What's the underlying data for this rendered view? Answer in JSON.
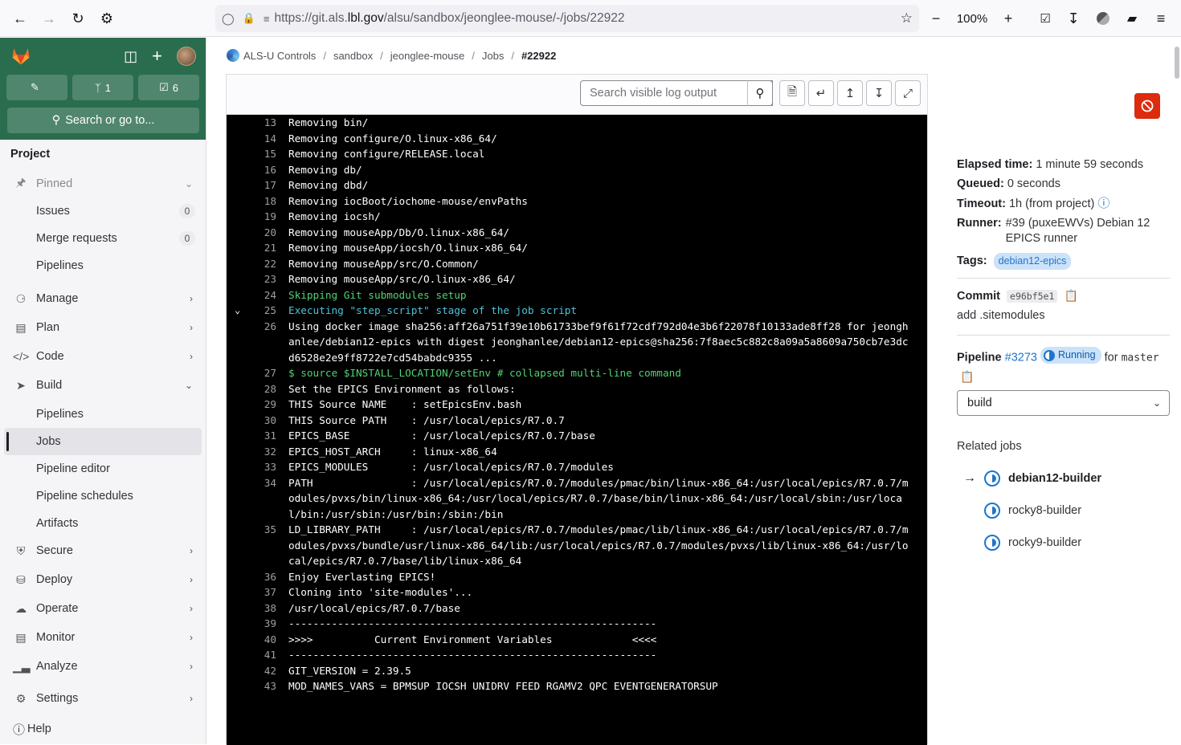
{
  "browser": {
    "url_prefix": "https://git.als.",
    "url_domain": "lbl.gov",
    "url_path": "/alsu/sandbox/jeonglee-mouse/-/jobs/22922",
    "zoom": "100%"
  },
  "sidebar": {
    "counters": [
      {
        "icon": "issues-icon",
        "value": ""
      },
      {
        "icon": "merge-request-icon",
        "value": "1"
      },
      {
        "icon": "todo-icon",
        "value": "6"
      }
    ],
    "search_label": "Search or go to...",
    "section_title": "Project",
    "pinned_label": "Pinned",
    "pinned_items": [
      {
        "label": "Issues",
        "count": "0"
      },
      {
        "label": "Merge requests",
        "count": "0"
      },
      {
        "label": "Pipelines",
        "count": ""
      }
    ],
    "groups": {
      "manage": "Manage",
      "plan": "Plan",
      "code": "Code",
      "build": "Build",
      "secure": "Secure",
      "deploy": "Deploy",
      "operate": "Operate",
      "monitor": "Monitor",
      "analyze": "Analyze",
      "settings": "Settings"
    },
    "build_items": [
      "Pipelines",
      "Jobs",
      "Pipeline editor",
      "Pipeline schedules",
      "Artifacts"
    ],
    "help_label": "Help"
  },
  "breadcrumb": {
    "org": "ALS-U Controls",
    "group": "sandbox",
    "project": "jeonglee-mouse",
    "section": "Jobs",
    "current": "#22922"
  },
  "log_toolbar": {
    "search_placeholder": "Search visible log output"
  },
  "log_lines": [
    {
      "n": "13",
      "t": "Removing bin/",
      "c": ""
    },
    {
      "n": "14",
      "t": "Removing configure/O.linux-x86_64/",
      "c": ""
    },
    {
      "n": "15",
      "t": "Removing configure/RELEASE.local",
      "c": ""
    },
    {
      "n": "16",
      "t": "Removing db/",
      "c": ""
    },
    {
      "n": "17",
      "t": "Removing dbd/",
      "c": ""
    },
    {
      "n": "18",
      "t": "Removing iocBoot/iochome-mouse/envPaths",
      "c": ""
    },
    {
      "n": "19",
      "t": "Removing iocsh/",
      "c": ""
    },
    {
      "n": "20",
      "t": "Removing mouseApp/Db/O.linux-x86_64/",
      "c": ""
    },
    {
      "n": "21",
      "t": "Removing mouseApp/iocsh/O.linux-x86_64/",
      "c": ""
    },
    {
      "n": "22",
      "t": "Removing mouseApp/src/O.Common/",
      "c": ""
    },
    {
      "n": "23",
      "t": "Removing mouseApp/src/O.linux-x86_64/",
      "c": ""
    },
    {
      "n": "24",
      "t": "Skipping Git submodules setup",
      "c": "green"
    },
    {
      "n": "25",
      "t": "Executing \"step_script\" stage of the job script",
      "c": "cyan"
    },
    {
      "n": "26",
      "t": "Using docker image sha256:aff26a751f39e10b61733bef9f61f72cdf792d04e3b6f22078f10133ade8ff28 for jeonghanlee/debian12-epics with digest jeonghanlee/debian12-epics@sha256:7f8aec5c882c8a09a5a8609a750cb7e3dcd6528e2e9ff8722e7cd54babdc9355 ...",
      "c": ""
    },
    {
      "n": "27",
      "t": "$ source $INSTALL_LOCATION/setEnv # collapsed multi-line command",
      "c": "green2"
    },
    {
      "n": "28",
      "t": "Set the EPICS Environment as follows:",
      "c": ""
    },
    {
      "n": "29",
      "t": "THIS Source NAME    : setEpicsEnv.bash",
      "c": ""
    },
    {
      "n": "30",
      "t": "THIS Source PATH    : /usr/local/epics/R7.0.7",
      "c": ""
    },
    {
      "n": "31",
      "t": "EPICS_BASE          : /usr/local/epics/R7.0.7/base",
      "c": ""
    },
    {
      "n": "32",
      "t": "EPICS_HOST_ARCH     : linux-x86_64",
      "c": ""
    },
    {
      "n": "33",
      "t": "EPICS_MODULES       : /usr/local/epics/R7.0.7/modules",
      "c": ""
    },
    {
      "n": "34",
      "t": "PATH                : /usr/local/epics/R7.0.7/modules/pmac/bin/linux-x86_64:/usr/local/epics/R7.0.7/modules/pvxs/bin/linux-x86_64:/usr/local/epics/R7.0.7/base/bin/linux-x86_64:/usr/local/sbin:/usr/local/bin:/usr/sbin:/usr/bin:/sbin:/bin",
      "c": ""
    },
    {
      "n": "35",
      "t": "LD_LIBRARY_PATH     : /usr/local/epics/R7.0.7/modules/pmac/lib/linux-x86_64:/usr/local/epics/R7.0.7/modules/pvxs/bundle/usr/linux-x86_64/lib:/usr/local/epics/R7.0.7/modules/pvxs/lib/linux-x86_64:/usr/local/epics/R7.0.7/base/lib/linux-x86_64",
      "c": ""
    },
    {
      "n": "36",
      "t": "Enjoy Everlasting EPICS!",
      "c": ""
    },
    {
      "n": "37",
      "t": "Cloning into 'site-modules'...",
      "c": ""
    },
    {
      "n": "38",
      "t": "/usr/local/epics/R7.0.7/base",
      "c": ""
    },
    {
      "n": "39",
      "t": "------------------------------------------------------------",
      "c": ""
    },
    {
      "n": "40",
      "t": ">>>>          Current Environment Variables             <<<<",
      "c": ""
    },
    {
      "n": "41",
      "t": "------------------------------------------------------------",
      "c": ""
    },
    {
      "n": "42",
      "t": "GIT_VERSION = 2.39.5",
      "c": ""
    },
    {
      "n": "43",
      "t": "MOD_NAMES_VARS = BPMSUP IOCSH UNIDRV FEED RGAMV2 QPC EVENTGENERATORSUP",
      "c": ""
    }
  ],
  "job": {
    "elapsed_label": "Elapsed time:",
    "elapsed_value": "1 minute 59 seconds",
    "queued_label": "Queued:",
    "queued_value": "0 seconds",
    "timeout_label": "Timeout:",
    "timeout_value": "1h (from project)",
    "runner_label": "Runner:",
    "runner_value": "#39 (puxeEWVs) Debian 12 EPICS runner",
    "tags_label": "Tags:",
    "tag": "debian12-epics",
    "commit_label": "Commit",
    "commit_sha": "e96bf5e1",
    "commit_message": "add .sitemodules",
    "pipeline_label": "Pipeline",
    "pipeline_id": "#3273",
    "pipeline_status": "Running",
    "pipeline_for": "for",
    "pipeline_branch": "master",
    "stage_selected": "build",
    "related_title": "Related jobs",
    "related_jobs": [
      "debian12-builder",
      "rocky8-builder",
      "rocky9-builder"
    ]
  },
  "colors": {
    "sidebar_top": "#2a6c4e",
    "cancel": "#dd2b0e",
    "link": "#1f75cb"
  }
}
